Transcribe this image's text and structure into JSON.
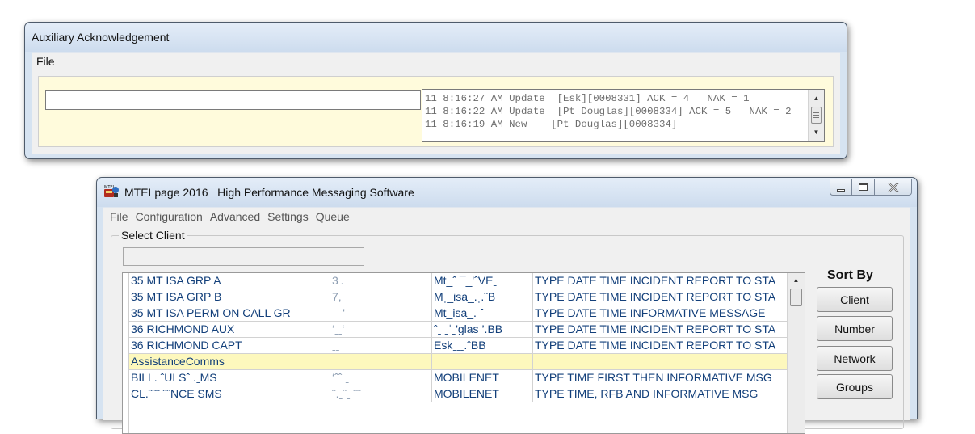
{
  "aux_window": {
    "title": "Auxiliary Acknowledgement",
    "menu": [
      "File"
    ],
    "input_value": "",
    "log_lines": [
      "11 8:16:27 AM Update  [Esk][0008331] ACK = 4   NAK = 1",
      "11 8:16:22 AM Update  [Pt Douglas][0008334] ACK = 5   NAK = 2",
      "11 8:16:19 AM New    [Pt Douglas][0008334]"
    ],
    "log_progress": 0.75
  },
  "main_window": {
    "title": "MTELpage 2016   High Performance Messaging Software",
    "menu": [
      "File",
      "Configuration",
      "Advanced",
      "Settings",
      "Queue"
    ],
    "group_label": "Select Client",
    "search_value": "",
    "rows": [
      {
        "client": "35 MT ISA GRP A",
        "number": "3 .   ",
        "network": "Mt_ˆ ¯_'ˆVEˍ",
        "description": "TYPE DATE TIME INCIDENT REPORT TO STA",
        "highlight": false
      },
      {
        "client": "35 MT ISA GRP B",
        "number": "7,",
        "network": "Mˌ_isa_.ˌ.ˆB",
        "description": "TYPE DATE TIME INCIDENT REPORT TO STA",
        "highlight": false
      },
      {
        "client": "35 MT ISA PERM ON CALL GR",
        "number": "ˍˍ '",
        "network": "Mt_isa_.ˍˆ",
        "description": "TYPE DATE TIME INFORMATIVE MESSAGE",
        "highlight": false
      },
      {
        "client": "36 RICHMOND AUX",
        "number": "‘ˍˍ‘",
        "network": "ˆˍ ˍˈˍ'glas ’.BB",
        "description": "TYPE DATE TIME INCIDENT REPORT TO STA",
        "highlight": false
      },
      {
        "client": "36 RICHMOND CAPT",
        "number": "ˍˍ",
        "network": "Eskˍˍˍ.ˆBB",
        "description": "TYPE DATE TIME INCIDENT REPORT TO STA",
        "highlight": false
      },
      {
        "client": "AssistanceComms",
        "number": "",
        "network": "",
        "description": "",
        "highlight": true
      },
      {
        "client": "BILL. ˆULSˆ .ˍMS",
        "number": "‘ˆˆ ˍ",
        "network": "MOBILENET",
        "description": "TYPE TIME FIRST THEN INFORMATIVE MSG",
        "highlight": false
      },
      {
        "client": "CL.ˆˆˆ ˆˆNCE SMS",
        "number": "ˆ.ˍˆˍ ˆˆ",
        "network": "MOBILENET",
        "description": "TYPE TIME, RFB AND INFORMATIVE MSG",
        "highlight": false
      }
    ],
    "sort_by": {
      "label": "Sort By",
      "buttons": [
        "Client",
        "Number",
        "Network",
        "Groups"
      ]
    }
  }
}
